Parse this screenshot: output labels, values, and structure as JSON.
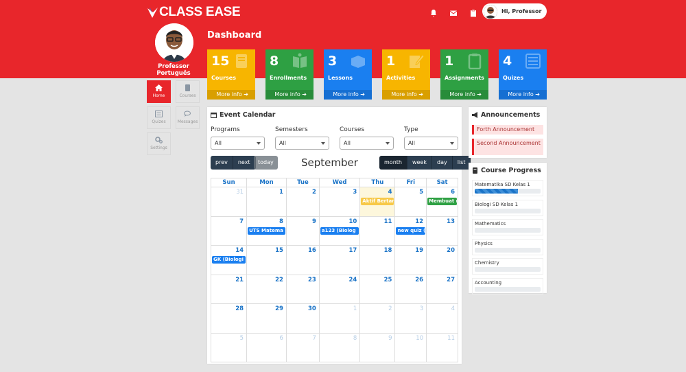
{
  "brand": {
    "name": "CLASS EASE",
    "color": "#e8262b"
  },
  "header": {
    "greeting": "Hi, Professor",
    "icons": [
      "bell-icon",
      "envelope-icon",
      "clipboard-icon"
    ]
  },
  "profile": {
    "name": "Professor Português"
  },
  "dashboard": {
    "title": "Dashboard"
  },
  "tiles": [
    {
      "count": "15",
      "label": "Courses",
      "more": "More info",
      "color": "#f7b500",
      "icon": "book-icon"
    },
    {
      "count": "8",
      "label": "Enrollments",
      "more": "More info",
      "color": "#2ea043",
      "icon": "open-book-icon"
    },
    {
      "count": "3",
      "label": "Lessons",
      "more": "More info",
      "color": "#1a7ff0",
      "icon": "box-icon"
    },
    {
      "count": "1",
      "label": "Activities",
      "more": "More info",
      "color": "#f7b500",
      "icon": "edit-icon"
    },
    {
      "count": "1",
      "label": "Assignments",
      "more": "More info",
      "color": "#2ea043",
      "icon": "clipboard-icon"
    },
    {
      "count": "4",
      "label": "Quizes",
      "more": "More info",
      "color": "#1a7ff0",
      "icon": "list-icon"
    }
  ],
  "sidenav": [
    {
      "label": "Home",
      "icon": "home-icon",
      "active": true
    },
    {
      "label": "Courses",
      "icon": "book-icon",
      "active": false
    },
    {
      "label": "Quizes",
      "icon": "list-icon",
      "active": false
    },
    {
      "label": "Messages",
      "icon": "chat-icon",
      "active": false
    },
    {
      "label": "Settings",
      "icon": "gears-icon",
      "active": false
    }
  ],
  "calendar": {
    "title": "Event Calendar",
    "filters": [
      {
        "label": "Programs",
        "value": "All"
      },
      {
        "label": "Semesters",
        "value": "All"
      },
      {
        "label": "Courses",
        "value": "All"
      },
      {
        "label": "Type",
        "value": "All"
      }
    ],
    "prev": "prev",
    "next": "next",
    "today": "today",
    "month": "September",
    "views": [
      "month",
      "week",
      "day",
      "list"
    ],
    "weekdays": [
      "Sun",
      "Mon",
      "Tue",
      "Wed",
      "Thu",
      "Fri",
      "Sat"
    ],
    "weeks": [
      [
        "31",
        "1",
        "2",
        "3",
        "4",
        "5",
        "6"
      ],
      [
        "7",
        "8",
        "9",
        "10",
        "11",
        "12",
        "13"
      ],
      [
        "14",
        "15",
        "16",
        "17",
        "18",
        "19",
        "20"
      ],
      [
        "21",
        "22",
        "23",
        "24",
        "25",
        "26",
        "27"
      ],
      [
        "28",
        "29",
        "30",
        "1",
        "2",
        "3",
        "4"
      ],
      [
        "5",
        "6",
        "7",
        "8",
        "9",
        "10",
        "11"
      ]
    ],
    "events": [
      {
        "week": 0,
        "day": 4,
        "text": "Aktif Bertan",
        "color": "#f7c948"
      },
      {
        "week": 0,
        "day": 6,
        "text": "Membuat mi",
        "color": "#2ea043"
      },
      {
        "week": 1,
        "day": 1,
        "text": "UTS Matema",
        "color": "#1a7ff0"
      },
      {
        "week": 1,
        "day": 3,
        "text": "a123 (Biolog",
        "color": "#1a7ff0"
      },
      {
        "week": 1,
        "day": 5,
        "text": "new quiz (Bi",
        "color": "#1a7ff0"
      },
      {
        "week": 2,
        "day": 0,
        "text": "GK (Biologi I",
        "color": "#1a7ff0"
      }
    ]
  },
  "announcements": {
    "title": "Announcements",
    "items": [
      "Forth Announcement",
      "Second Announcement"
    ]
  },
  "course_progress": {
    "title": "Course Progress",
    "items": [
      {
        "name": "Matematika SD Kelas 1",
        "progress": 0.66
      },
      {
        "name": "Biologi SD Kelas 1",
        "progress": 0
      },
      {
        "name": "Mathematics",
        "progress": 0
      },
      {
        "name": "Physics",
        "progress": 0
      },
      {
        "name": "Chemistry",
        "progress": 0
      },
      {
        "name": "Accounting",
        "progress": 0
      }
    ]
  }
}
